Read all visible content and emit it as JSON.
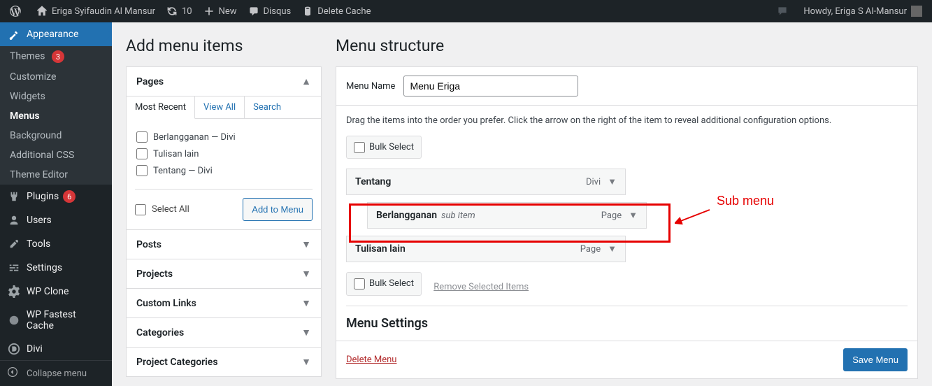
{
  "adminbar": {
    "site_name": "Eriga Syifaudin Al Mansur",
    "updates_count": "10",
    "new_label": "New",
    "disqus_label": "Disqus",
    "delete_cache_label": "Delete Cache",
    "howdy_text": "Howdy, Eriga S Al-Mansur"
  },
  "sidebar": {
    "appearance": {
      "label": "Appearance"
    },
    "appearance_sub": {
      "themes": "Themes",
      "themes_badge": "3",
      "customize": "Customize",
      "widgets": "Widgets",
      "menus": "Menus",
      "background": "Background",
      "additional_css": "Additional CSS",
      "theme_editor": "Theme Editor"
    },
    "plugins": {
      "label": "Plugins",
      "badge": "6"
    },
    "users": {
      "label": "Users"
    },
    "tools": {
      "label": "Tools"
    },
    "settings": {
      "label": "Settings"
    },
    "wpclone": {
      "label": "WP Clone"
    },
    "wpfc": {
      "label": "WP Fastest Cache"
    },
    "divi": {
      "label": "Divi"
    },
    "collapse": "Collapse menu"
  },
  "columns": {
    "left_heading": "Add menu items",
    "right_heading": "Menu structure"
  },
  "pages_box": {
    "title": "Pages",
    "tabs": {
      "recent": "Most Recent",
      "view_all": "View All",
      "search": "Search"
    },
    "items": {
      "0": "Berlangganan — Divi",
      "1": "Tulisan lain",
      "2": "Tentang — Divi"
    },
    "select_all": "Select All",
    "add_button": "Add to Menu"
  },
  "accordions": {
    "posts": "Posts",
    "projects": "Projects",
    "custom_links": "Custom Links",
    "categories": "Categories",
    "project_categories": "Project Categories"
  },
  "menu_edit": {
    "name_label": "Menu Name",
    "name_value": "Menu Eriga",
    "help_text": "Drag the items into the order you prefer. Click the arrow on the right of the item to reveal additional configuration options.",
    "bulk_select": "Bulk Select",
    "remove_selected": "Remove Selected Items",
    "items": {
      "0": {
        "title": "Tentang",
        "type": "Divi"
      },
      "1": {
        "title": "Berlangganan",
        "subtitle": "sub item",
        "type": "Page"
      },
      "2": {
        "title": "Tulisan lain",
        "type": "Page"
      }
    },
    "settings_heading": "Menu Settings",
    "delete_link": "Delete Menu",
    "save_button": "Save Menu"
  },
  "annotation": {
    "text": "Sub menu"
  }
}
